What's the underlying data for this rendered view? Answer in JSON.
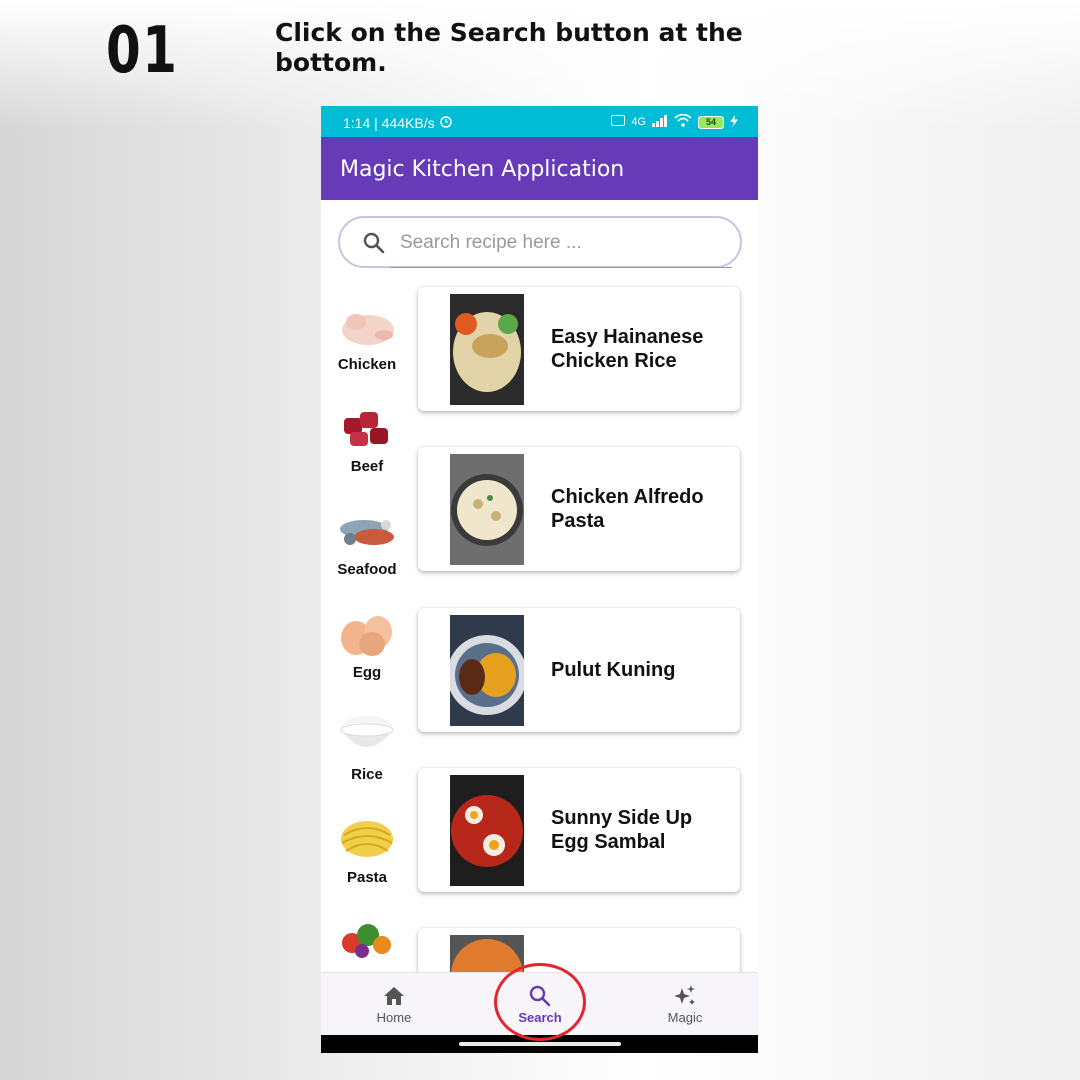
{
  "instruction": {
    "step": "01",
    "text": "Click on the Search button at the bottom."
  },
  "status_bar": {
    "left_text": "1:14 | 444KB/s",
    "network": "4G",
    "battery": "54"
  },
  "app_bar": {
    "title": "Magic Kitchen Application"
  },
  "search": {
    "placeholder": "Search recipe here ..."
  },
  "categories": [
    {
      "label": "Chicken",
      "icon": "chicken-image"
    },
    {
      "label": "Beef",
      "icon": "beef-image"
    },
    {
      "label": "Seafood",
      "icon": "seafood-image"
    },
    {
      "label": "Egg",
      "icon": "egg-image"
    },
    {
      "label": "Rice",
      "icon": "rice-image"
    },
    {
      "label": "Pasta",
      "icon": "pasta-image"
    },
    {
      "label": "",
      "icon": "vegetables-image"
    }
  ],
  "recipes": [
    {
      "name": "Easy Hainanese Chicken Rice"
    },
    {
      "name": "Chicken Alfredo Pasta"
    },
    {
      "name": "Pulut Kuning"
    },
    {
      "name": "Sunny Side Up Egg Sambal"
    },
    {
      "name": ""
    }
  ],
  "bottom_nav": {
    "items": [
      {
        "label": "Home",
        "icon": "home-icon",
        "active": false
      },
      {
        "label": "Search",
        "icon": "search-icon",
        "active": true
      },
      {
        "label": "Magic",
        "icon": "sparkle-icon",
        "active": false
      }
    ]
  },
  "colors": {
    "status_bar": "#00bcd4",
    "app_bar": "#673ab7",
    "active_nav": "#673ab7",
    "annotation": "#e3262b"
  }
}
